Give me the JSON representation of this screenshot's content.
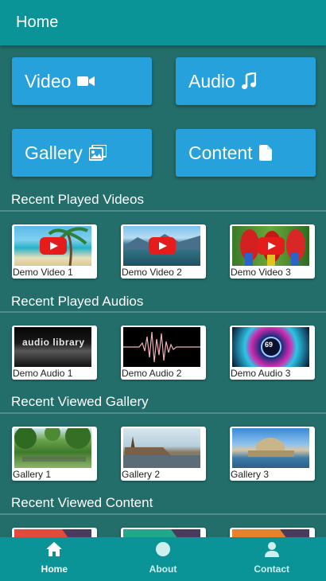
{
  "header": {
    "title": "Home"
  },
  "tiles": [
    {
      "label": "Video",
      "icon": "video-camera-icon"
    },
    {
      "label": "Audio",
      "icon": "music-note-icon"
    },
    {
      "label": "Gallery",
      "icon": "image-icon"
    },
    {
      "label": "Content",
      "icon": "document-icon"
    }
  ],
  "sections": {
    "videos": {
      "title": "Recent Played Videos",
      "items": [
        "Demo Video 1",
        "Demo Video 2",
        "Demo Video 3"
      ]
    },
    "audios": {
      "title": "Recent Played Audios",
      "items": [
        "Demo Audio 1",
        "Demo Audio 2",
        "Demo Audio 3"
      ]
    },
    "gallery": {
      "title": "Recent Viewed Gallery",
      "items": [
        "Gallery 1",
        "Gallery 2",
        "Gallery 3"
      ]
    },
    "content": {
      "title": "Recent Viewed Content"
    }
  },
  "audio_thumb_texts": {
    "library": "audio library",
    "level": "69"
  },
  "nav": [
    {
      "label": "Home",
      "icon": "home-icon"
    },
    {
      "label": "About",
      "icon": "circle-icon"
    },
    {
      "label": "Contact",
      "icon": "person-icon"
    }
  ],
  "colors": {
    "header": "#0b9497",
    "background": "#236e6b",
    "tile": "#27a1dc"
  }
}
